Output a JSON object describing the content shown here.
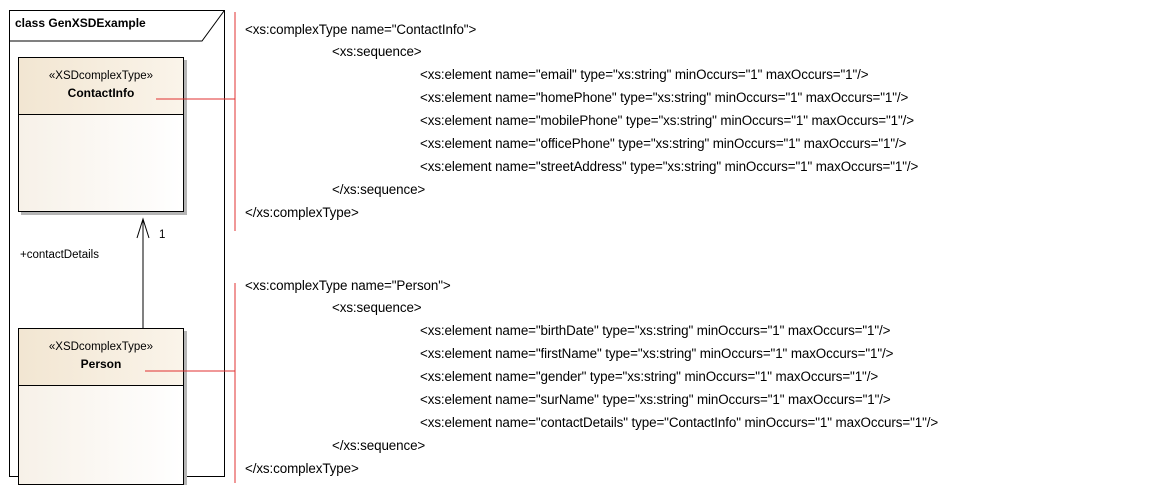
{
  "diagram": {
    "frame_title": "class GenXSDExample",
    "classes": [
      {
        "stereotype": "«XSDcomplexType»",
        "name": "ContactInfo"
      },
      {
        "stereotype": "«XSDcomplexType»",
        "name": "Person"
      }
    ],
    "association": {
      "role": "+contactDetails",
      "multiplicity": "1"
    }
  },
  "code_blocks": [
    {
      "lines": [
        "<xs:complexType name=\"ContactInfo\">",
        "<xs:sequence>",
        "<xs:element name=\"email\" type=\"xs:string\" minOccurs=\"1\" maxOccurs=\"1\"/>",
        "<xs:element name=\"homePhone\" type=\"xs:string\" minOccurs=\"1\" maxOccurs=\"1\"/>",
        "<xs:element name=\"mobilePhone\" type=\"xs:string\" minOccurs=\"1\" maxOccurs=\"1\"/>",
        "<xs:element name=\"officePhone\" type=\"xs:string\" minOccurs=\"1\" maxOccurs=\"1\"/>",
        "<xs:element name=\"streetAddress\" type=\"xs:string\" minOccurs=\"1\" maxOccurs=\"1\"/>",
        "</xs:sequence>",
        "</xs:complexType>"
      ]
    },
    {
      "lines": [
        "<xs:complexType name=\"Person\">",
        "<xs:sequence>",
        "<xs:element name=\"birthDate\" type=\"xs:string\" minOccurs=\"1\" maxOccurs=\"1\"/>",
        "<xs:element name=\"firstName\" type=\"xs:string\" minOccurs=\"1\" maxOccurs=\"1\"/>",
        "<xs:element name=\"gender\" type=\"xs:string\" minOccurs=\"1\" maxOccurs=\"1\"/>",
        "<xs:element name=\"surName\" type=\"xs:string\" minOccurs=\"1\" maxOccurs=\"1\"/>",
        "<xs:element name=\"contactDetails\" type=\"ContactInfo\" minOccurs=\"1\" maxOccurs=\"1\"/>",
        "</xs:sequence>",
        "</xs:complexType>"
      ]
    }
  ],
  "colors": {
    "connector": "#e03030",
    "class_fill": "#f2e6d2",
    "frame_line": "#000000"
  }
}
